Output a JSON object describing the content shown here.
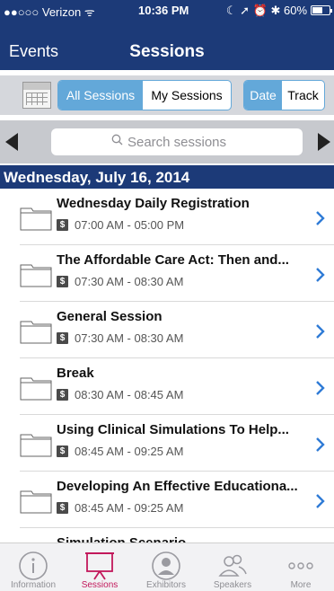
{
  "status_bar": {
    "carrier": "●●○○○ Verizon ᯤ",
    "time": "10:36 PM",
    "right_text": "☾ ➚ ⏰ ✱ 60%",
    "battery_percent": 60
  },
  "nav": {
    "back_label": "Events",
    "title": "Sessions"
  },
  "filters": {
    "calendar_icon": "calendar-icon",
    "session_options": [
      "All Sessions",
      "My Sessions"
    ],
    "session_selected": "All Sessions",
    "sort_options": [
      "Date",
      "Track"
    ],
    "sort_selected": "Date"
  },
  "search": {
    "placeholder": "Search sessions"
  },
  "section": {
    "date_header": "Wednesday, July 16, 2014"
  },
  "sessions": [
    {
      "name": "Wednesday Daily Registration",
      "badge": "$",
      "time": "07:00 AM - 05:00 PM"
    },
    {
      "name": "The Affordable Care Act: Then and...",
      "badge": "$",
      "time": "07:30 AM - 08:30 AM"
    },
    {
      "name": "General Session",
      "badge": "$",
      "time": "07:30 AM - 08:30 AM"
    },
    {
      "name": "Break",
      "badge": "$",
      "time": "08:30 AM - 08:45 AM"
    },
    {
      "name": "Using Clinical Simulations To Help...",
      "badge": "$",
      "time": "08:45 AM - 09:25 AM"
    },
    {
      "name": "Developing An Effective Educationa...",
      "badge": "$",
      "time": "08:45 AM - 09:25 AM"
    },
    {
      "name": "Simulation Scenario...",
      "badge": "$",
      "time": ""
    }
  ],
  "tabs": [
    {
      "label": "Information",
      "icon": "info-icon"
    },
    {
      "label": "Sessions",
      "icon": "presentation-icon",
      "active": true
    },
    {
      "label": "Exhibitors",
      "icon": "person-circle-icon"
    },
    {
      "label": "Speakers",
      "icon": "people-icon"
    },
    {
      "label": "More",
      "icon": "more-dots-icon"
    }
  ],
  "colors": {
    "nav_blue": "#1c3a78",
    "accent_blue": "#63a8d9",
    "chevron_blue": "#2f7bd6",
    "active_tab": "#c2185b"
  }
}
